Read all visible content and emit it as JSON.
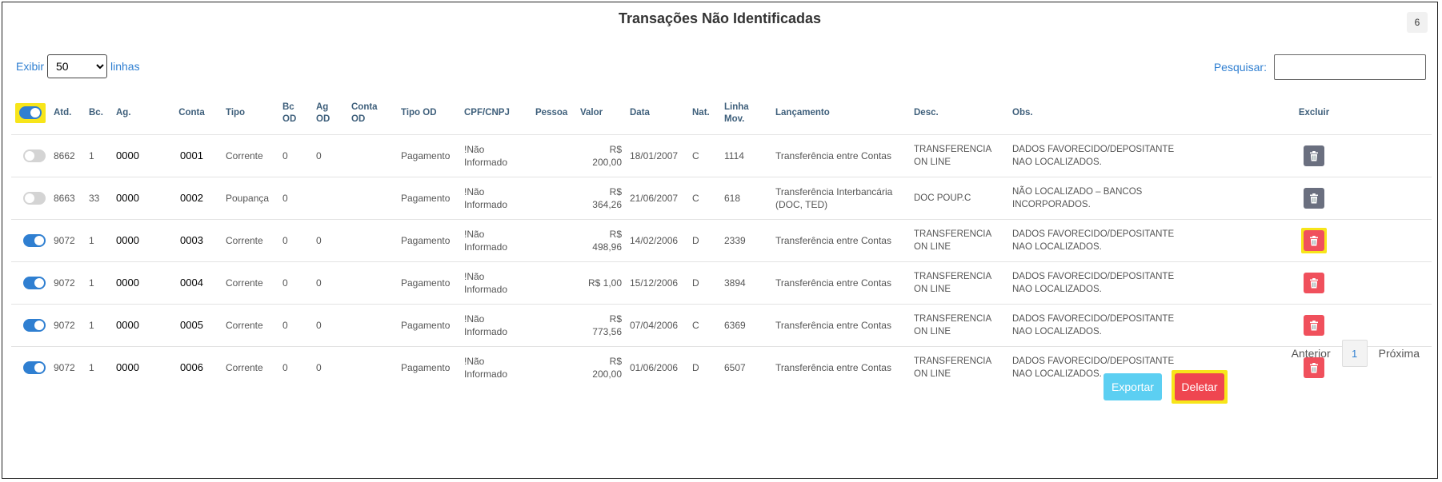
{
  "header": {
    "title": "Transações Não Identificadas",
    "badge": "6"
  },
  "length": {
    "prefix": "Exibir",
    "selected": "50",
    "suffix": "linhas"
  },
  "search": {
    "label": "Pesquisar:",
    "value": ""
  },
  "columns": [
    "Atd.",
    "Bc.",
    "Ag.",
    "Conta",
    "Tipo",
    "Bc OD",
    "Ag OD",
    "Conta OD",
    "Tipo OD",
    "CPF/CNPJ",
    "Pessoa",
    "Valor",
    "Data",
    "Nat.",
    "Linha Mov.",
    "Lançamento",
    "Desc.",
    "Obs.",
    "Excluir"
  ],
  "rows": [
    {
      "selected": false,
      "atd": "8662",
      "bc": "1",
      "ag": "0000",
      "conta": "0001",
      "tipo": "Corrente",
      "bc_od": "0",
      "ag_od": "0",
      "conta_od": "",
      "tipo_od": "Pagamento",
      "cpf": "!Não Informado",
      "pessoa": "",
      "valor": "R$ 200,00",
      "data": "18/01/2007",
      "nat": "C",
      "linha": "1114",
      "lancamento": "Transferência entre Contas",
      "desc": "TRANSFERENCIA ON LINE",
      "obs": "DADOS FAVORECIDO/DEPOSITANTE NAO LOCALIZADOS.",
      "excluir_enabled": false
    },
    {
      "selected": false,
      "atd": "8663",
      "bc": "33",
      "ag": "0000",
      "conta": "0002",
      "tipo": "Poupança",
      "bc_od": "0",
      "ag_od": "",
      "conta_od": "",
      "tipo_od": "Pagamento",
      "cpf": "!Não Informado",
      "pessoa": "",
      "valor": "R$ 364,26",
      "data": "21/06/2007",
      "nat": "C",
      "linha": "618",
      "lancamento": "Transferência Interbancária (DOC, TED)",
      "desc": "DOC POUP.C",
      "obs": "NÃO LOCALIZADO – BANCOS INCORPORADOS.",
      "excluir_enabled": false
    },
    {
      "selected": true,
      "atd": "9072",
      "bc": "1",
      "ag": "0000",
      "conta": "0003",
      "tipo": "Corrente",
      "bc_od": "0",
      "ag_od": "0",
      "conta_od": "",
      "tipo_od": "Pagamento",
      "cpf": "!Não Informado",
      "pessoa": "",
      "valor": "R$ 498,96",
      "data": "14/02/2006",
      "nat": "D",
      "linha": "2339",
      "lancamento": "Transferência entre Contas",
      "desc": "TRANSFERENCIA ON LINE",
      "obs": "DADOS FAVORECIDO/DEPOSITANTE NAO LOCALIZADOS.",
      "excluir_enabled": true,
      "highlight": true
    },
    {
      "selected": true,
      "atd": "9072",
      "bc": "1",
      "ag": "0000",
      "conta": "0004",
      "tipo": "Corrente",
      "bc_od": "0",
      "ag_od": "0",
      "conta_od": "",
      "tipo_od": "Pagamento",
      "cpf": "!Não Informado",
      "pessoa": "",
      "valor": "R$ 1,00",
      "data": "15/12/2006",
      "nat": "D",
      "linha": "3894",
      "lancamento": "Transferência entre Contas",
      "desc": "TRANSFERENCIA ON LINE",
      "obs": "DADOS FAVORECIDO/DEPOSITANTE NAO LOCALIZADOS.",
      "excluir_enabled": true
    },
    {
      "selected": true,
      "atd": "9072",
      "bc": "1",
      "ag": "0000",
      "conta": "0005",
      "tipo": "Corrente",
      "bc_od": "0",
      "ag_od": "0",
      "conta_od": "",
      "tipo_od": "Pagamento",
      "cpf": "!Não Informado",
      "pessoa": "",
      "valor": "R$ 773,56",
      "data": "07/04/2006",
      "nat": "C",
      "linha": "6369",
      "lancamento": "Transferência entre Contas",
      "desc": "TRANSFERENCIA ON LINE",
      "obs": "DADOS FAVORECIDO/DEPOSITANTE NAO LOCALIZADOS.",
      "excluir_enabled": true
    },
    {
      "selected": true,
      "atd": "9072",
      "bc": "1",
      "ag": "0000",
      "conta": "0006",
      "tipo": "Corrente",
      "bc_od": "0",
      "ag_od": "0",
      "conta_od": "",
      "tipo_od": "Pagamento",
      "cpf": "!Não Informado",
      "pessoa": "",
      "valor": "R$ 200,00",
      "data": "01/06/2006",
      "nat": "D",
      "linha": "6507",
      "lancamento": "Transferência entre Contas",
      "desc": "TRANSFERENCIA ON LINE",
      "obs": "DADOS FAVORECIDO/DEPOSITANTE NAO LOCALIZADOS.",
      "excluir_enabled": true
    }
  ],
  "pagination": {
    "prev": "Anterior",
    "current": "1",
    "next": "Próxima"
  },
  "actions": {
    "export_label": "Exportar",
    "delete_label": "Deletar"
  },
  "colors": {
    "accent": "#2f7fd1",
    "danger": "#ef4650",
    "export": "#5ccff2",
    "highlight": "#f7e51a",
    "disabled_delete": "#6a6f7f"
  }
}
